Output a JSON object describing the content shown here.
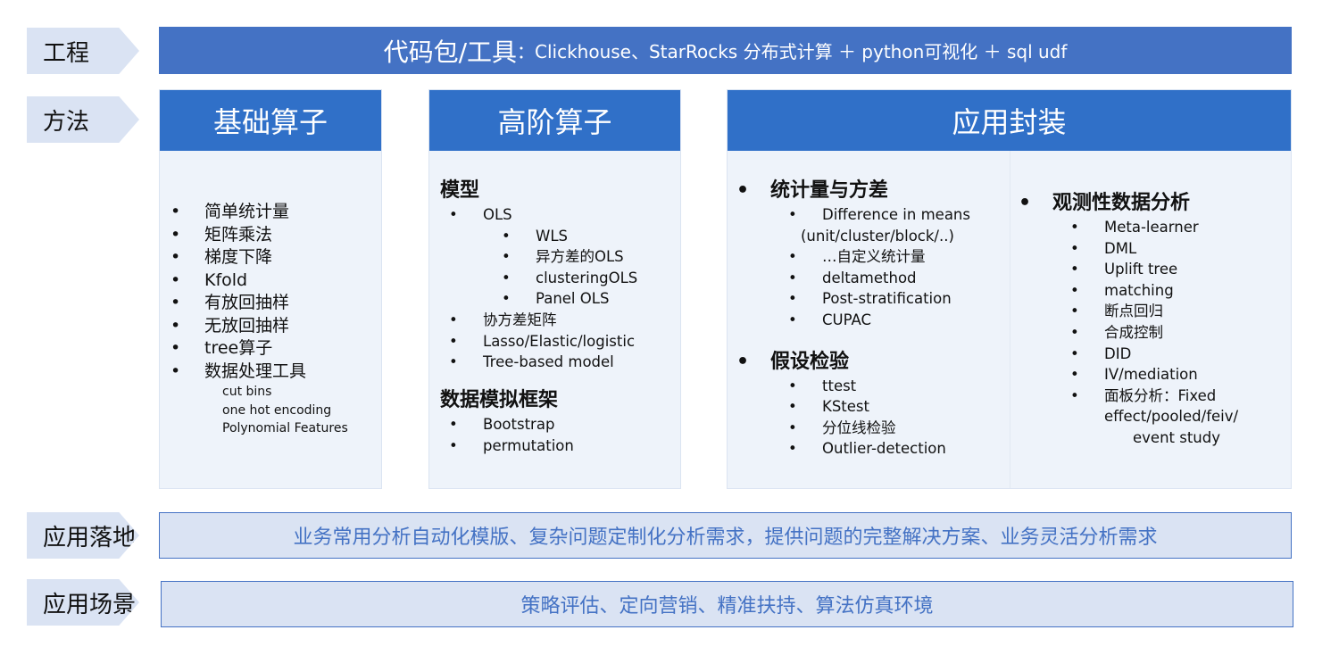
{
  "rows": {
    "engineering": "工程",
    "method": "方法",
    "landing": "应用落地",
    "scenario": "应用场景"
  },
  "engineering_bar": {
    "title": "代码包/工具",
    "content": "：Clickhouse、StarRocks 分布式计算 ＋ python可视化 ＋ sql udf"
  },
  "basic": {
    "header": "基础算子",
    "items": [
      "简单统计量",
      "矩阵乘法",
      "梯度下降",
      "Kfold",
      "有放回抽样",
      "无放回抽样",
      "tree算子",
      "数据处理工具"
    ],
    "subitems": [
      "cut bins",
      "one hot encoding",
      "Polynomial Features"
    ]
  },
  "advanced": {
    "header": "高阶算子",
    "model_title": "模型",
    "model_items": [
      {
        "label": "OLS",
        "level": 1
      },
      {
        "label": "WLS",
        "level": 2
      },
      {
        "label": "异方差的OLS",
        "level": 2
      },
      {
        "label": "clusteringOLS",
        "level": 2
      },
      {
        "label": "Panel OLS",
        "level": 2
      },
      {
        "label": "协方差矩阵",
        "level": 1
      },
      {
        "label": "Lasso/Elastic/logistic",
        "level": 1
      },
      {
        "label": "Tree-based model",
        "level": 1
      }
    ],
    "sim_title": "数据模拟框架",
    "sim_items": [
      "Bootstrap",
      "permutation"
    ]
  },
  "application": {
    "header": "应用封装",
    "stats_title": "统计量与方差",
    "stats_items": [
      "Difference in means",
      "(unit/cluster/block/..)",
      "…自定义统计量",
      "deltamethod",
      "Post-stratification",
      "CUPAC"
    ],
    "test_title": "假设检验",
    "test_items": [
      "ttest",
      "KStest",
      "分位线检验",
      "Outlier-detection"
    ],
    "obs_title": "观测性数据分析",
    "obs_items": [
      "Meta-learner",
      "DML",
      "Uplift tree",
      "matching",
      "断点回归",
      "合成控制",
      "DID",
      "IV/mediation",
      "面板分析：Fixed"
    ],
    "obs_cont": [
      "effect/pooled/feiv/",
      "event study"
    ]
  },
  "landing_text": "业务常用分析自动化模版、复杂问题定制化分析需求，提供问题的完整解决方案、业务灵活分析需求",
  "scenario_text": "策略评估、定向营销、精准扶持、算法仿真环境",
  "colors": {
    "bar": "#4472C4",
    "header": "#3070C8",
    "tag": "#DAE3F3",
    "body": "#EEF3FA"
  }
}
